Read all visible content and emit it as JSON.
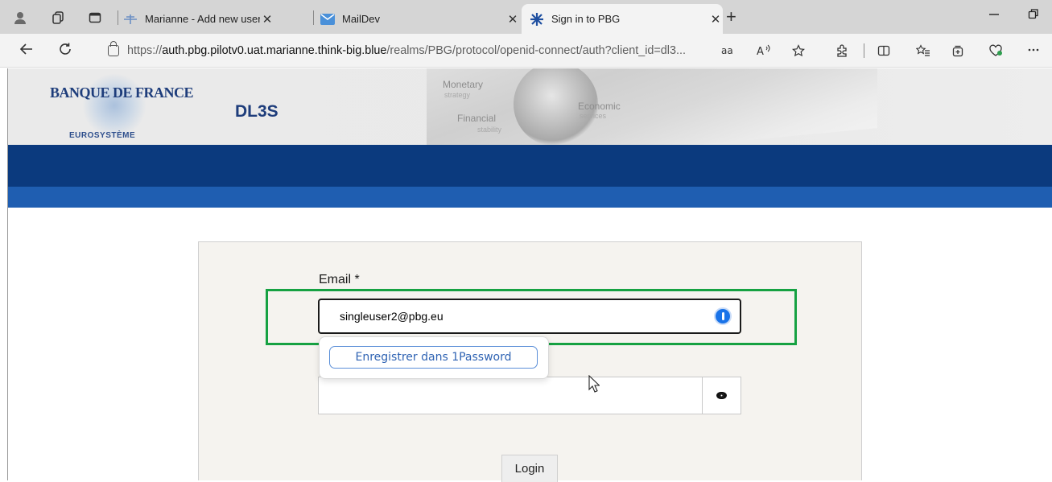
{
  "browser": {
    "tabs": [
      {
        "title": "Marianne - Add new user",
        "icon": "marianne-icon",
        "active": false
      },
      {
        "title": "MailDev",
        "icon": "mail-icon",
        "active": false
      },
      {
        "title": "Sign in to PBG",
        "icon": "pbg-star-icon",
        "active": true
      }
    ],
    "close_glyph": "✕",
    "new_tab_glyph": "+",
    "address": {
      "prefix": "https://",
      "host": "auth.pbg.pilotv0.uat.marianne.think-big.blue",
      "path": "/realms/PBG/protocol/openid-connect/auth?client_id=dl3..."
    }
  },
  "header": {
    "logo_text": "BANQUE DE FRANCE",
    "logo_subtitle": "EUROSYSTÈME",
    "app_name": "DL3S",
    "banner": {
      "monetary": "Monetary",
      "strategy": "strategy",
      "economic": "Economic",
      "services": "services",
      "financial": "Financial",
      "stability": "stability"
    }
  },
  "colors": {
    "band_dark": "#0b3a7e",
    "band_light": "#1f5eb1",
    "highlight": "#16a142",
    "onepassword": "#1a73e8"
  },
  "form": {
    "email_label": "Email *",
    "email_value": "singleuser2@pbg.eu",
    "onepassword_save_label": "Enregistrer dans 1Password",
    "password_value": "",
    "login_label": "Login"
  }
}
